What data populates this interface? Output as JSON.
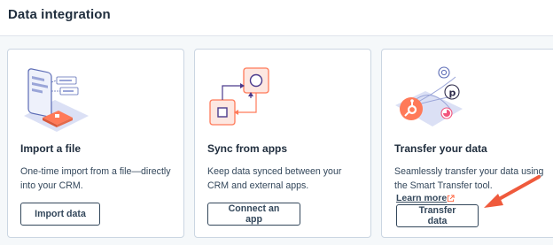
{
  "page": {
    "title": "Data integration"
  },
  "cards": [
    {
      "title": "Import a file",
      "description": "One-time import from a file—directly into your CRM.",
      "button_label": "Import data"
    },
    {
      "title": "Sync from apps",
      "description": "Keep data synced between your CRM and external apps.",
      "button_label": "Connect an app"
    },
    {
      "title": "Transfer your data",
      "description": "Seamlessly transfer your data using the Smart Transfer tool.",
      "link_label": "Learn more",
      "button_label": "Transfer data"
    }
  ],
  "colors": {
    "accent_orange": "#ff7a59",
    "annotation_arrow": "#ef5a3c",
    "text_dark": "#33475b",
    "border": "#cbd6e2"
  },
  "icons": {
    "import_illustration": "phone-file-import-illustration",
    "sync_illustration": "app-sync-illustration",
    "transfer_illustration": "hubspot-transfer-illustration",
    "external_link": "external-link-icon"
  }
}
